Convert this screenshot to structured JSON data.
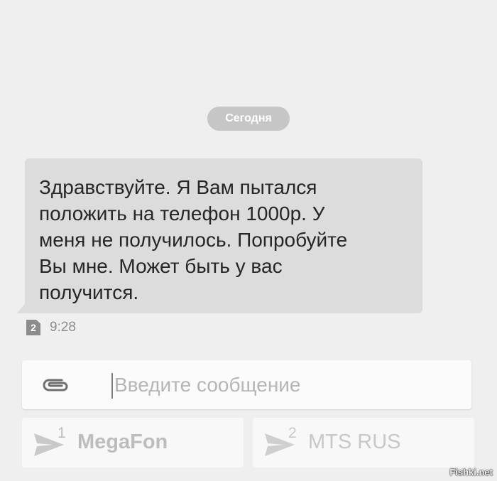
{
  "date_chip": {
    "label": "Сегодня"
  },
  "message": {
    "text": "Здравствуйте. Я Вам пытался\nположить на телефон 1000р. У\nменя не получилось. Попробуйте\nВы мне. Может быть у вас\nполучится.",
    "sim_badge": "2",
    "time": "9:28"
  },
  "compose": {
    "placeholder": "Введите сообщение",
    "attach_icon": "paperclip-icon"
  },
  "send_buttons": [
    {
      "sim": "1",
      "label": "MegaFon",
      "icon": "send-icon"
    },
    {
      "sim": "2",
      "label": "MTS RUS",
      "icon": "send-icon"
    }
  ],
  "watermark": "Fishki.net"
}
